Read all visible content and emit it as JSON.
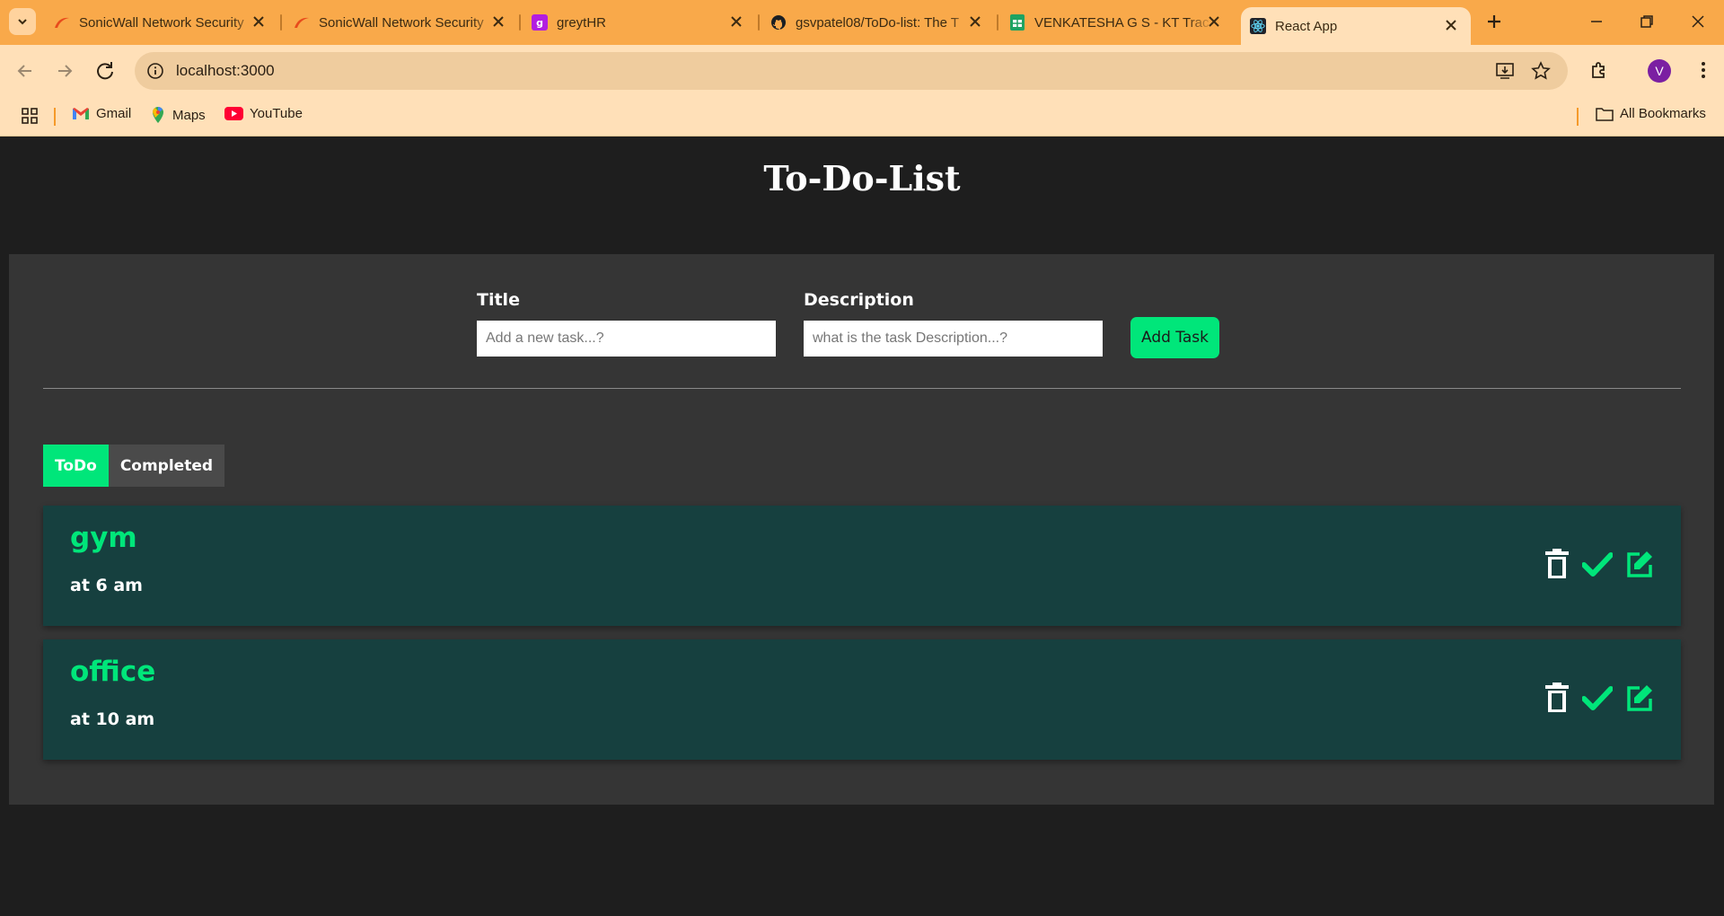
{
  "browser": {
    "tabs": [
      {
        "title": "SonicWall Network Security",
        "icon": "sonicwall-icon",
        "active": false
      },
      {
        "title": "SonicWall Network Security",
        "icon": "sonicwall-icon",
        "active": false
      },
      {
        "title": "greytHR",
        "icon": "greythr-icon",
        "active": false
      },
      {
        "title": "gsvpatel08/ToDo-list: The T",
        "icon": "github-icon",
        "active": false
      },
      {
        "title": "VENKATESHA G S - KT Trac",
        "icon": "google-sheets-icon",
        "active": false
      },
      {
        "title": "React App",
        "icon": "react-icon",
        "active": true
      }
    ],
    "address": "localhost:3000",
    "profile_initial": "V",
    "bookmarks": [
      {
        "label": "Gmail",
        "icon": "gmail-icon"
      },
      {
        "label": "Maps",
        "icon": "maps-icon"
      },
      {
        "label": "YouTube",
        "icon": "youtube-icon"
      }
    ],
    "all_bookmarks_label": "All Bookmarks",
    "colors": {
      "tabbar": "#f9a94a",
      "toolbar": "#ffe0b8"
    }
  },
  "app": {
    "title": "To-Do-List",
    "form": {
      "title_label": "Title",
      "title_placeholder": "Add a new task...?",
      "title_value": "",
      "description_label": "Description",
      "description_placeholder": "what is the task Description...?",
      "description_value": "",
      "add_button": "Add Task"
    },
    "filters": {
      "todo": "ToDo",
      "completed": "Completed",
      "selected": "ToDo"
    },
    "todos": [
      {
        "title": "gym",
        "description": "at 6 am"
      },
      {
        "title": "office",
        "description": "at 10 am"
      }
    ],
    "colors": {
      "accent": "#00e67a",
      "card": "#16403f",
      "panel": "#353535",
      "background": "#1e1e1e"
    }
  }
}
